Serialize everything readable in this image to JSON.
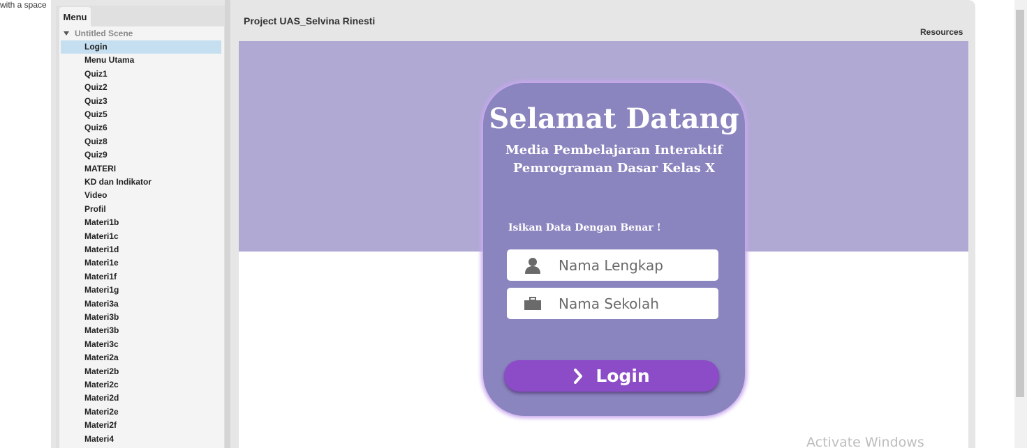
{
  "corner_text": "with a space",
  "menu_tab": "Menu",
  "scene": "Untitled Scene",
  "tree_items": [
    "Login",
    "Menu Utama",
    "Quiz1",
    "Quiz2",
    "Quiz3",
    "Quiz5",
    "Quiz6",
    "Quiz8",
    "Quiz9",
    "MATERI",
    "KD dan Indikator",
    "Video",
    "Profil",
    "Materi1b",
    "Materi1c",
    "Materi1d",
    "Materi1e",
    "Materi1f",
    "Materi1g",
    "Materi3a",
    "Materi3b",
    "Materi3b",
    "Materi3c",
    "Materi2a",
    "Materi2b",
    "Materi2c",
    "Materi2d",
    "Materi2e",
    "Materi2f",
    "Materi4"
  ],
  "selected_item": "Login",
  "project_title": "Project UAS_Selvina Rinesti",
  "resources": "Resources",
  "card": {
    "welcome": "Selamat Datang",
    "subtitle_1": "Media Pembelajaran Interaktif",
    "subtitle_2": "Pemrograman Dasar Kelas X",
    "instruction": "Isikan Data Dengan Benar !",
    "name_placeholder": "Nama Lengkap",
    "school_placeholder": "Nama Sekolah",
    "login_label": "Login"
  },
  "watermark": "Activate Windows",
  "colors": {
    "stage_top": "#b0a9d4",
    "card": "#8a84bf",
    "button": "#8c4bc7",
    "selected": "#c5dff0"
  },
  "icons": [
    "triangle-down-icon",
    "user-icon",
    "briefcase-icon",
    "chevron-right-icon"
  ]
}
